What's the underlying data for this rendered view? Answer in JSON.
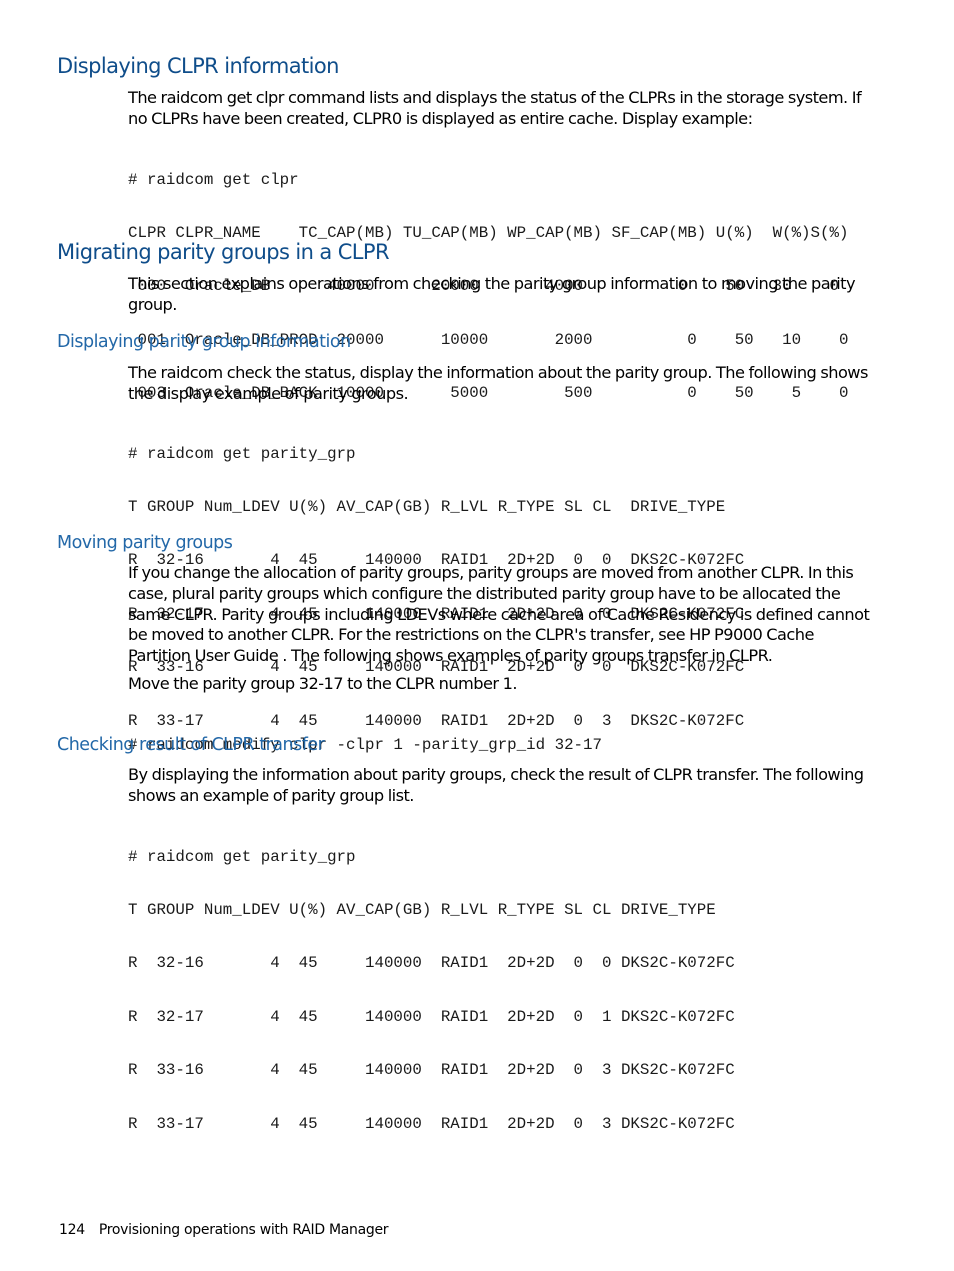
{
  "sections": {
    "clpr_info": {
      "heading": "Displaying CLPR information",
      "paragraph": "The raidcom get clpr command lists and displays the status of the CLPRs in the storage system. If no CLPRs have been created, CLPR0 is displayed as entire cache. Display example:",
      "code": [
        "# raidcom get clpr",
        "CLPR CLPR_NAME    TC_CAP(MB) TU_CAP(MB) WP_CAP(MB) SF_CAP(MB) U(%)  W(%)S(%)",
        " 000  Oracle_DB      40000      20000       4000          0    50   30    0",
        " 001  Oracle_DB_PROD  20000      10000       2000          0    50   10    0",
        " 003  Oracle_DB_BACK  10000       5000        500          0    50    5    0"
      ]
    },
    "migrating": {
      "heading": "Migrating parity groups in a CLPR",
      "paragraph": "This section explains operations from checking the parity group information to moving the parity group."
    },
    "parity_info": {
      "heading": "Displaying parity group information",
      "paragraph": "The raidcom check the status, display the information about the parity group. The following shows the display example of parity groups.",
      "code": [
        "# raidcom get parity_grp",
        "T GROUP Num_LDEV U(%) AV_CAP(GB) R_LVL R_TYPE SL CL  DRIVE_TYPE",
        "R  32-16       4  45     140000  RAID1  2D+2D  0  0  DKS2C-K072FC",
        "R  32-17       4  45     140000  RAID1  2D+2D  0  0  DKS2C-K072FC",
        "R  33-16       4  45     140000  RAID1  2D+2D  0  0  DKS2C-K072FC",
        "R  33-17       4  45     140000  RAID1  2D+2D  0  3  DKS2C-K072FC"
      ]
    },
    "moving": {
      "heading": "Moving parity groups",
      "paragraph": "If you change the allocation of parity groups, parity groups are moved from another CLPR. In this case, plural parity groups which configure the distributed parity group have to be allocated the same CLPR. Parity groups including LDEVs where cache area of Cache Residency is defined cannot be moved to another CLPR. For the restrictions on the CLPR's transfer, see HP P9000 Cache Partition User Guide . The following shows examples of parity groups transfer in CLPR.",
      "paragraph2": "Move the parity group 32-17 to the CLPR number 1.",
      "code": [
        "# raidcom modify clpr -clpr 1 -parity_grp_id 32-17"
      ]
    },
    "checking": {
      "heading": "Checking result of CLPR transfer",
      "paragraph": "By displaying the information about parity groups, check the result of CLPR transfer. The following shows an example of parity group list.",
      "code": [
        "# raidcom get parity_grp",
        "T GROUP Num_LDEV U(%) AV_CAP(GB) R_LVL R_TYPE SL CL DRIVE_TYPE",
        "R  32-16       4  45     140000  RAID1  2D+2D  0  0 DKS2C-K072FC",
        "R  32-17       4  45     140000  RAID1  2D+2D  0  1 DKS2C-K072FC",
        "R  33-16       4  45     140000  RAID1  2D+2D  0  3 DKS2C-K072FC",
        "R  33-17       4  45     140000  RAID1  2D+2D  0  3 DKS2C-K072FC"
      ]
    }
  },
  "footer": {
    "page_number": "124",
    "chapter_title": "Provisioning operations with RAID Manager"
  }
}
